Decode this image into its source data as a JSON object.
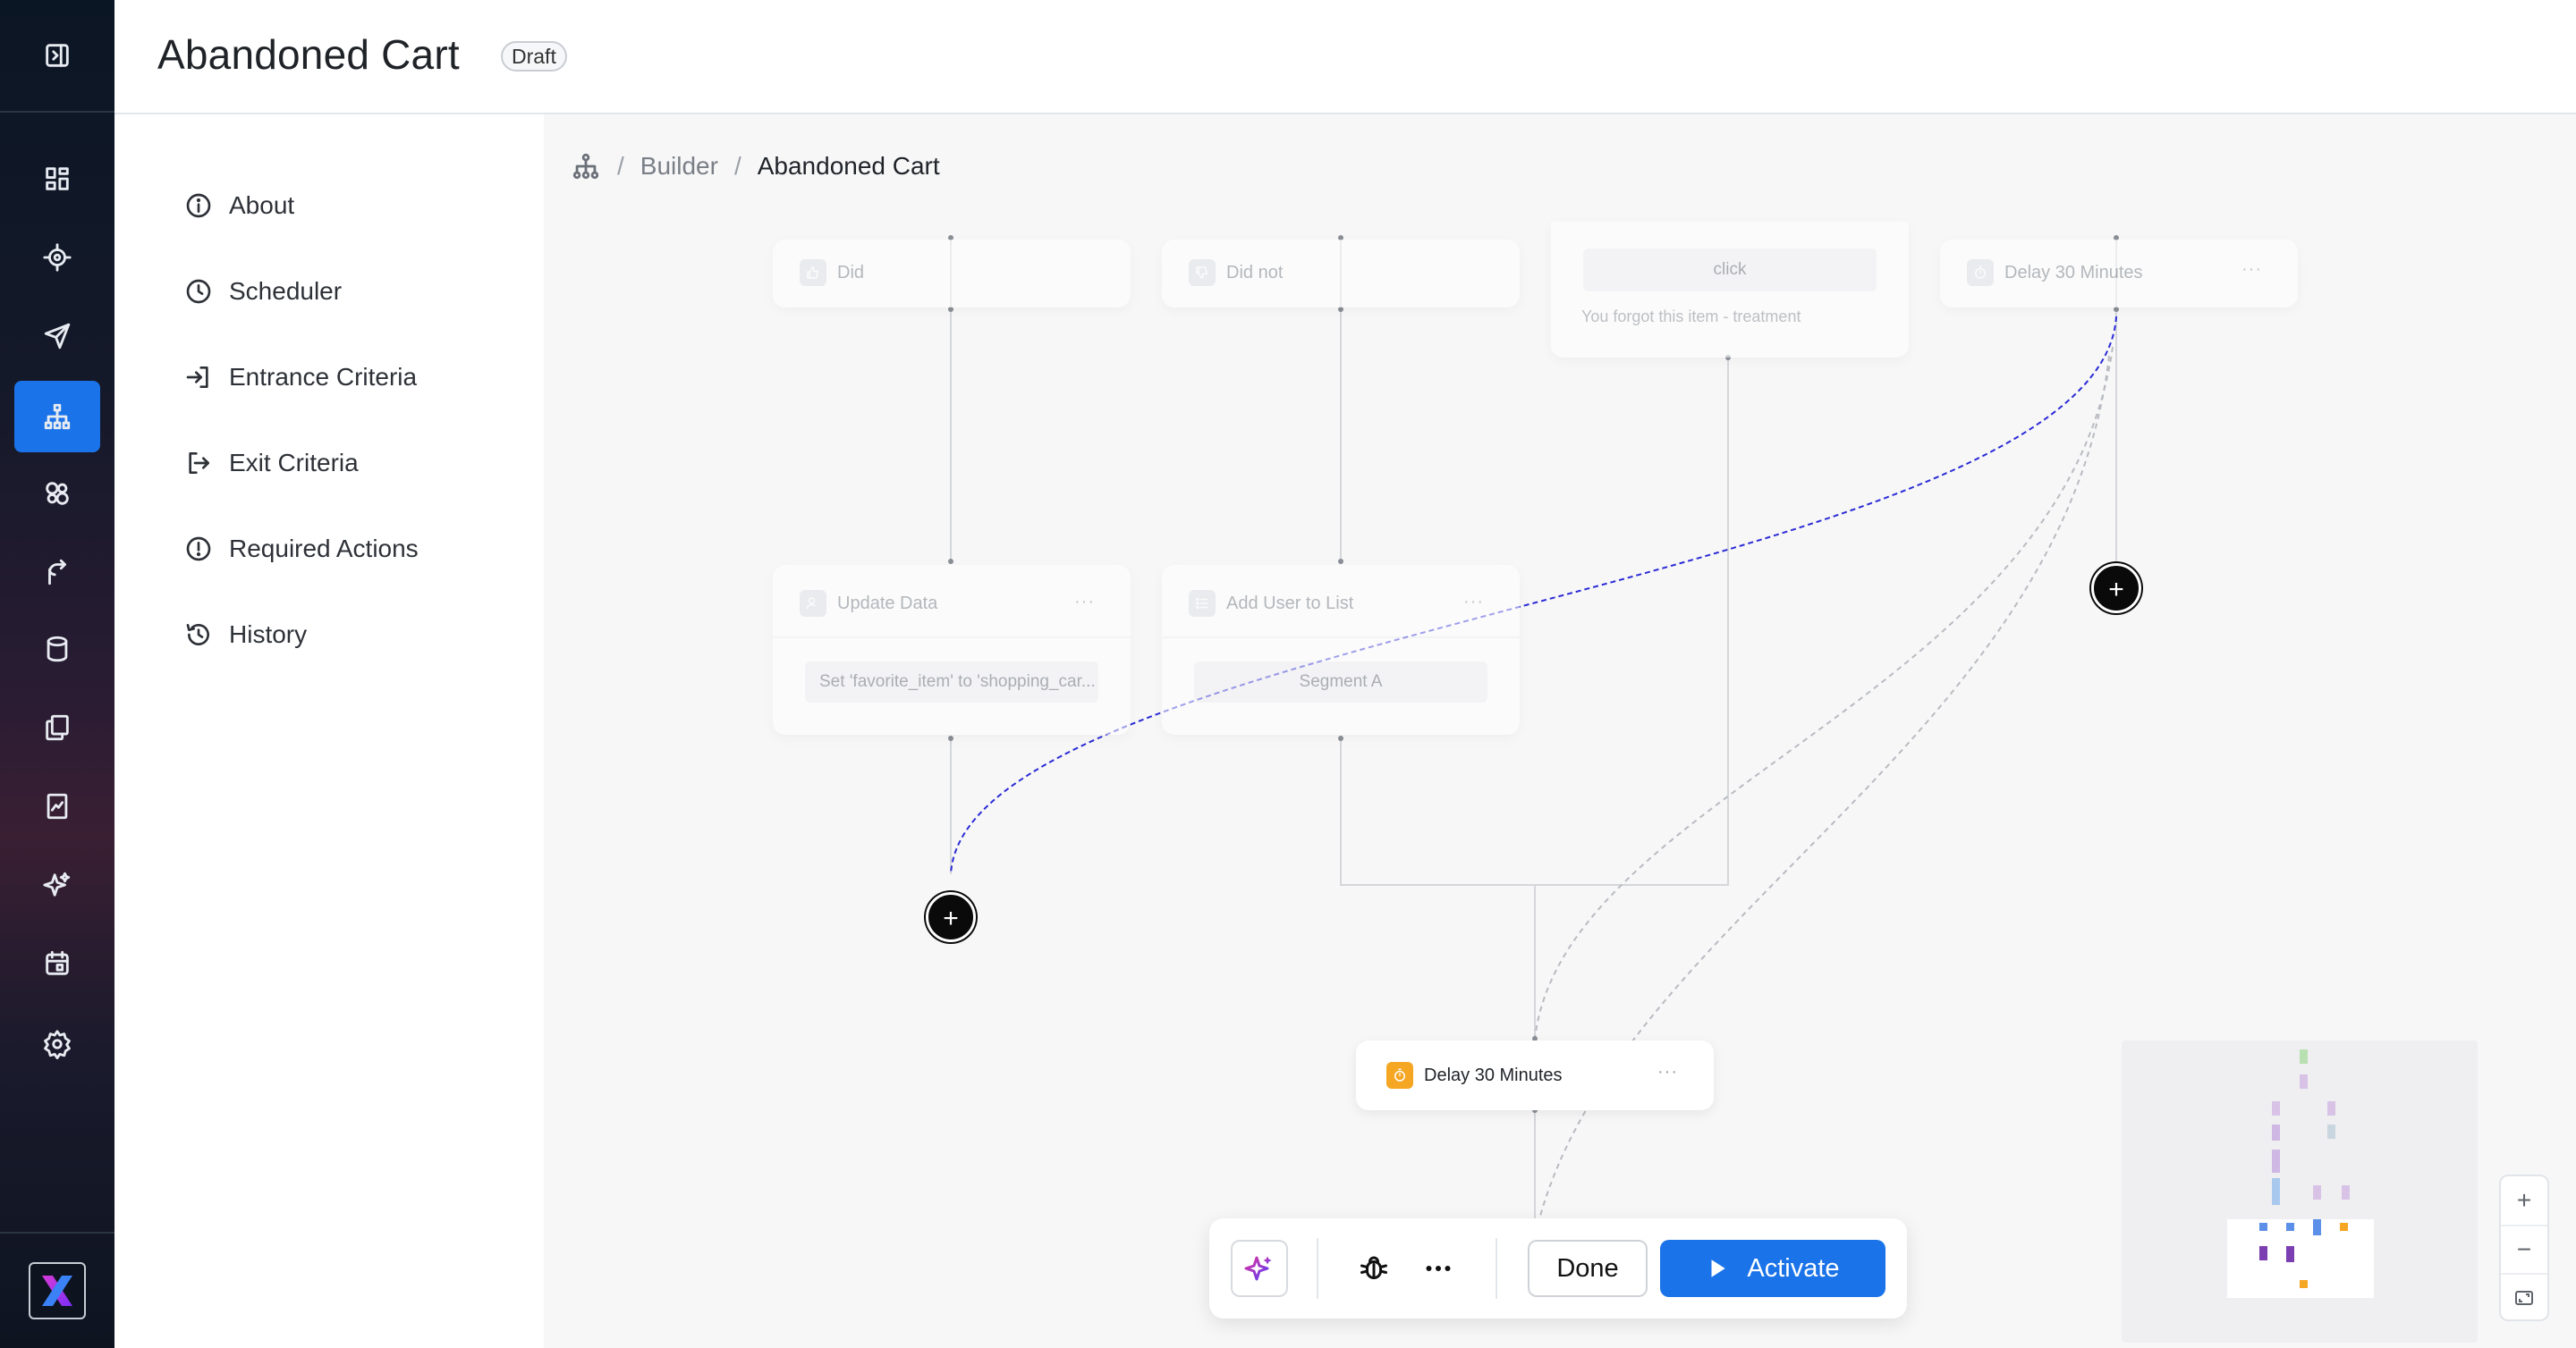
{
  "header": {
    "title": "Abandoned Cart",
    "status_badge": "Draft"
  },
  "rail": {
    "items": [
      {
        "name": "toggle-sidebar-icon"
      },
      {
        "name": "dashboard-icon"
      },
      {
        "name": "target-icon"
      },
      {
        "name": "send-icon"
      },
      {
        "name": "journey-builder-icon",
        "active": true
      },
      {
        "name": "segments-icon"
      },
      {
        "name": "flow-icon"
      },
      {
        "name": "database-icon"
      },
      {
        "name": "templates-icon"
      },
      {
        "name": "analytics-icon"
      },
      {
        "name": "sparkle-icon"
      },
      {
        "name": "calendar-icon"
      },
      {
        "name": "settings-icon"
      }
    ],
    "accent_color": "#1a73e8"
  },
  "subnav": {
    "items": [
      {
        "label": "About",
        "icon": "info-icon"
      },
      {
        "label": "Scheduler",
        "icon": "clock-icon"
      },
      {
        "label": "Entrance Criteria",
        "icon": "enter-icon"
      },
      {
        "label": "Exit Criteria",
        "icon": "exit-icon"
      },
      {
        "label": "Required Actions",
        "icon": "alert-icon"
      },
      {
        "label": "History",
        "icon": "history-icon"
      }
    ]
  },
  "breadcrumb": {
    "root_icon": "sitemap-icon",
    "parent": "Builder",
    "current": "Abandoned Cart",
    "separator": "/"
  },
  "nodes": {
    "did": {
      "label": "Did"
    },
    "did_not": {
      "label": "Did not"
    },
    "email": {
      "field": "click",
      "subtitle": "You forgot this item - treatment"
    },
    "delay_top": {
      "label": "Delay 30 Minutes"
    },
    "update_data": {
      "label": "Update Data",
      "field": "Set 'favorite_item' to 'shopping_car..."
    },
    "add_to_list": {
      "label": "Add User to List",
      "field": "Segment A"
    },
    "delay_bottom": {
      "label": "Delay 30 Minutes",
      "icon_color": "#f5a623"
    }
  },
  "toolbar": {
    "done_label": "Done",
    "activate_label": "Activate"
  },
  "zoom": {
    "in": "+",
    "out": "−"
  },
  "colors": {
    "wire_active": "#2b2bd6",
    "wire": "#b8bbc0"
  }
}
